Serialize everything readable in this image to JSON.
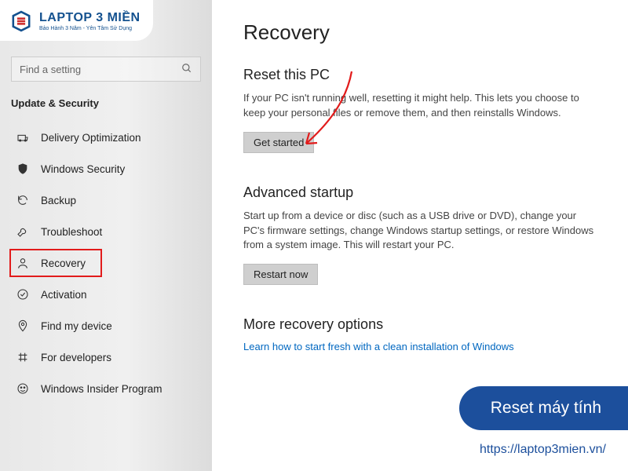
{
  "logo": {
    "main": "LAPTOP 3 MIỀN",
    "sub": "Bảo Hành 3 Năm - Yên Tâm Sử Dụng"
  },
  "search": {
    "placeholder": "Find a setting"
  },
  "section_title": "Update & Security",
  "nav": {
    "items": [
      {
        "label": "Delivery Optimization",
        "icon": "delivery-icon"
      },
      {
        "label": "Windows Security",
        "icon": "shield-icon"
      },
      {
        "label": "Backup",
        "icon": "backup-icon"
      },
      {
        "label": "Troubleshoot",
        "icon": "wrench-icon"
      },
      {
        "label": "Recovery",
        "icon": "recovery-icon",
        "highlight": true
      },
      {
        "label": "Activation",
        "icon": "check-circle-icon"
      },
      {
        "label": "Find my device",
        "icon": "location-icon"
      },
      {
        "label": "For developers",
        "icon": "developers-icon"
      },
      {
        "label": "Windows Insider Program",
        "icon": "insider-icon"
      }
    ]
  },
  "main": {
    "title": "Recovery",
    "reset": {
      "heading": "Reset this PC",
      "desc": "If your PC isn't running well, resetting it might help. This lets you choose to keep your personal files or remove them, and then reinstalls Windows.",
      "button": "Get started"
    },
    "advanced": {
      "heading": "Advanced startup",
      "desc": "Start up from a device or disc (such as a USB drive or DVD), change your PC's firmware settings, change Windows startup settings, or restore Windows from a system image. This will restart your PC.",
      "button": "Restart now"
    },
    "more": {
      "heading": "More recovery options",
      "link": "Learn how to start fresh with a clean installation of Windows"
    }
  },
  "annotation": {
    "badge": "Reset máy tính",
    "url": "https://laptop3mien.vn/"
  }
}
